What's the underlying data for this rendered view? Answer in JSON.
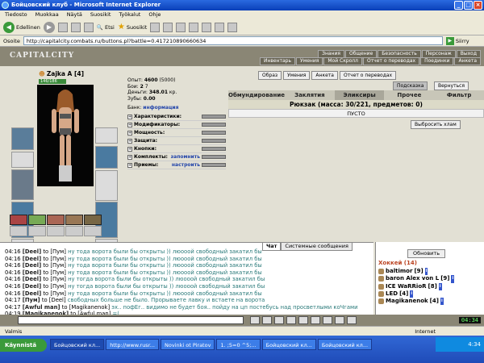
{
  "window": {
    "title": "Бойцовский клуб - Microsoft Internet Explorer"
  },
  "menu": [
    "Tiedosto",
    "Muokkaa",
    "Näytä",
    "Suosikit",
    "Työkalut",
    "Ohje"
  ],
  "toolbar": {
    "back": "Edellinen",
    "search": "Etsi",
    "favorites": "Suosikit"
  },
  "address": {
    "label": "Osoite",
    "url": "http://capitalcity.combats.ru/buttons.pl?battle=0.417210890660634",
    "go": "Siirry"
  },
  "game": {
    "logo": "CAPITALCITY",
    "nav1": [
      "Знания",
      "Общение",
      "Безопасность",
      "Персонаж",
      "Выход"
    ],
    "nav2": [
      "Инвентарь",
      "Умения",
      "Мой Скролл",
      "Отчет о переводах",
      "Поединки",
      "Анкета"
    ]
  },
  "character": {
    "name": "Zajka A",
    "level": "[4]",
    "hp": "146/186",
    "stats": [
      {
        "label": "Опыт:",
        "value": "4600",
        "extra": "(5000)"
      },
      {
        "label": "Бои:",
        "value": "2",
        "extra": "7"
      },
      {
        "label": "Деньги:",
        "value": "348.01",
        "extra": "кр."
      },
      {
        "label": "Зубы:",
        "value": "0.00",
        "extra": ""
      }
    ],
    "bank": {
      "label": "Банк:",
      "link": "информация"
    },
    "params": [
      {
        "label": "Характеристики:",
        "link": ""
      },
      {
        "label": "Модификаторы:",
        "link": ""
      },
      {
        "label": "Мощность:",
        "link": ""
      },
      {
        "label": "Защита:",
        "link": ""
      },
      {
        "label": "Кнопки:",
        "link": ""
      },
      {
        "label": "Комплекты:",
        "link": "запомнить"
      },
      {
        "label": "Приемы:",
        "link": "настроить"
      }
    ]
  },
  "rightTop": [
    "Образ",
    "Умения",
    "Анкета",
    "Отчет о переводах"
  ],
  "hint": "Подсказка",
  "refresh": "Вернуться",
  "invTabs": [
    {
      "label": "Обмундирование",
      "active": false
    },
    {
      "label": "Заклятия",
      "active": false
    },
    {
      "label": "Эликсиры",
      "active": true
    },
    {
      "label": "Прочее",
      "active": false
    },
    {
      "label": "Фильтр",
      "active": false
    }
  ],
  "backpack": "Рюкзак (масса: 30/221, предметов: 0)",
  "empty": "ПУСТО",
  "throwBtn": "Выбросить хлам",
  "chat": {
    "tabs": [
      "Чат",
      "Системные сообщения"
    ],
    "messages": [
      {
        "time": "04:16",
        "name": "[Deel]",
        "to": "to [Пум]",
        "text": "ну тода ворота были бы открыты )) люооой свободный закатил бы"
      },
      {
        "time": "04:16",
        "name": "[Deel]",
        "to": "to [Пум]",
        "text": "ну тода ворота были бы открыты )) люооой свободный закатил бы"
      },
      {
        "time": "04:16",
        "name": "[Deel]",
        "to": "to [Пум]",
        "text": "ну тода ворота были бы открыты )) люооой свободный закатил бы"
      },
      {
        "time": "04:16",
        "name": "[Deel]",
        "to": "to [Пум]",
        "text": "ну тода ворота были бы открыты )) люооой свободный закатил бы"
      },
      {
        "time": "04:16",
        "name": "[Deel]",
        "to": "to [Пум]",
        "text": "ну тогда ворота были бы открыты )) люооой свободный закатил бы"
      },
      {
        "time": "04:16",
        "name": "[Deel]",
        "to": "to [Пум]",
        "text": "ну тогда ворота были бы открыты )) люооой свободный закатил бы"
      },
      {
        "time": "04:16",
        "name": "[Deel]",
        "to": "to [Пум]",
        "text": "ну тода ворота были бы открыты )) люооой свободный закатил бы"
      },
      {
        "time": "04:17",
        "name": "[Пум]",
        "to": "to [Deel]",
        "text": "свободных больше не было. Прорываете лавку и встаете на ворота"
      },
      {
        "time": "04:17",
        "name": "[Awful man]",
        "to": "to [Magikanenok]",
        "text": "эх.. пофЕг.. видимо не будет боя.. пойду на цп постебусь над просветлыми коЧгами"
      },
      {
        "time": "04:19",
        "name": "[Magikanenok]",
        "to": "to [Awful man]",
        "text": "=("
      }
    ]
  },
  "users": {
    "update": "Обновить",
    "room": "Хоккей (14)",
    "list": [
      {
        "name": "baltimor",
        "level": "[9]"
      },
      {
        "name": "baron Alex von L",
        "level": "[9]"
      },
      {
        "name": "ICE WaRRioR",
        "level": "[8]"
      },
      {
        "name": "LED",
        "level": "[4]"
      },
      {
        "name": "Magikanenok",
        "level": "[4]"
      }
    ]
  },
  "clock": "04:34",
  "status": {
    "left": "Valmis",
    "zone": "Internet"
  },
  "taskbar": {
    "start": "Käynnistä",
    "tasks": [
      "Бойцовский кл...",
      "http://www.rusr...",
      "Novinki ot Piratov",
      "1. ;5=0 ^5;...",
      "Бойцовский кл...",
      "Бойцовский кл..."
    ],
    "time": "4:34"
  }
}
